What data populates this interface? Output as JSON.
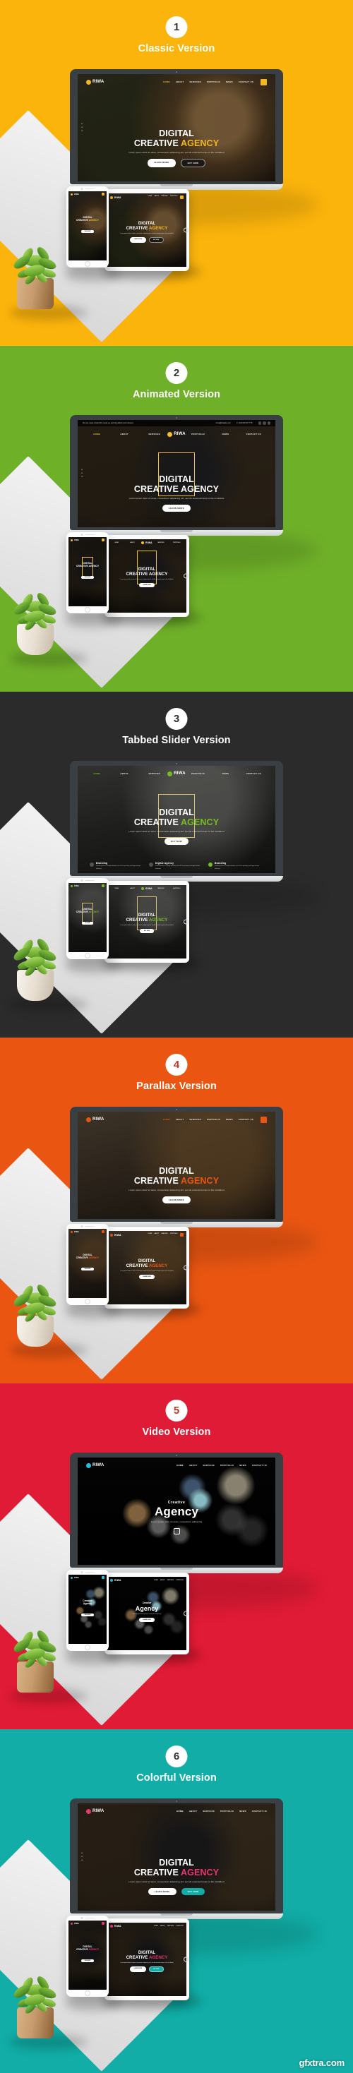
{
  "sections": [
    {
      "number": "1",
      "title": "Classic Version",
      "bg_color": "#FBB40C",
      "badge_num_color": "#333333",
      "accent": "#F2B722",
      "site": {
        "logo": "RIWA",
        "nav": [
          "HOME",
          "ABOUT",
          "SERVICES",
          "PORTFOLIO",
          "NEWS",
          "CONTACT US"
        ],
        "hero_line1": "DIGITAL",
        "hero_line2_plain": "CREATIVE ",
        "hero_line2_accent": "AGENCY",
        "hero_sub": "Lorem ipsum dolor sit amet, consectetur adipiscing elit, sed do eiusmod tempo to the incididunt",
        "btn_primary": "LEARN MORE",
        "btn_secondary": "BUY NOW",
        "side_labels": [
          "01",
          "02",
          "03"
        ]
      }
    },
    {
      "number": "2",
      "title": "Animated Version",
      "bg_color": "#6FB029",
      "badge_num_color": "#333333",
      "accent": "#F2C12E",
      "site": {
        "logo": "RIWA",
        "topbar_left": "We can create a brand the needs we and truly affects your business",
        "topbar_mail": "hq@riwasite.com",
        "topbar_phone": "+234 000 33 77 55",
        "nav": [
          "HOME",
          "ABOUT",
          "SERVICES",
          "PORTFOLIO",
          "NEWS",
          "CONTACT US"
        ],
        "hero_line1": "DIGITAL",
        "hero_line2_plain": "CREATIVE AGENCY",
        "hero_line2_accent": "",
        "hero_sub": "Lorem ipsum dolor sit amet, consectetur adipiscing elit, sed do eiusmodt temp to the incididunt",
        "btn_primary": "LEARN MORE",
        "btn_secondary": "",
        "side_labels": [
          "01",
          "02",
          "03"
        ]
      }
    },
    {
      "number": "3",
      "title": "Tabbed Slider  Version",
      "bg_color": "#2B2B2B",
      "badge_num_color": "#333333",
      "accent": "#79B928",
      "site": {
        "logo": "RIWA",
        "nav": [
          "HOME",
          "ABOUT",
          "SERVICES",
          "PORTFOLIO",
          "NEWS",
          "CONTACT US"
        ],
        "hero_line1": "DIGITAL",
        "hero_line2_plain": "CREATIVE ",
        "hero_line2_accent": "AGENCY",
        "hero_sub": "Lorem ipsum dolor sit amet, consectetur adipiscing elit, sed do eiusmod tempo to the incididunt",
        "btn_primary": "BUY NOW",
        "btn_secondary": "",
        "side_labels": [],
        "tabs": [
          {
            "label": "Branding",
            "desc": "Lorem ipsum is simply dummy text of the printing and typesetting industry",
            "active": false
          },
          {
            "label": "Digital Agency",
            "desc": "Lorem ipsum is simply dummy text of the printing and typesetting industry",
            "active": false
          },
          {
            "label": "Branding",
            "desc": "Lorem ipsum is simply dummy text of the printing and typesetting industry",
            "active": true
          }
        ]
      }
    },
    {
      "number": "4",
      "title": "Parallax Version",
      "bg_color": "#EA5612",
      "badge_num_color": "#C0392B",
      "accent": "#EA5612",
      "site": {
        "logo": "RIWA",
        "nav": [
          "HOME",
          "ABOUT",
          "SERVICES",
          "PORTFOLIO",
          "NEWS",
          "CONTACT US"
        ],
        "hero_line1": "DIGITAL",
        "hero_line2_plain": "CREATIVE ",
        "hero_line2_accent": "AGENCY",
        "hero_sub": "Lorem ipsum dolor sit amet, consectetur adipiscing elit, sed do eiusmod tempo to the incididunt",
        "btn_primary": "LEARN MORE",
        "btn_secondary": "",
        "side_labels": []
      }
    },
    {
      "number": "5",
      "title": "Video Version",
      "bg_color": "#E01B35",
      "badge_num_color": "#C0392B",
      "accent": "#22C2DE",
      "site": {
        "logo": "RIWA",
        "nav": [
          "HOME",
          "ABOUT",
          "SERVICES",
          "PORTFOLIO",
          "NEWS",
          "CONTACT US"
        ],
        "hero_line1": "Creative",
        "hero_line2_plain": "Agency",
        "hero_line2_accent": "",
        "hero_sub": "Lorem ipsum dolor sit amet, consectetur adipiscing",
        "btn_primary": "LEARN MORE",
        "btn_secondary": "",
        "side_labels": []
      }
    },
    {
      "number": "6",
      "title": "Colorful Version",
      "bg_color": "#11ADA6",
      "badge_num_color": "#333333",
      "accent": "#E8376E",
      "site": {
        "logo": "RIWA",
        "nav": [
          "HOME",
          "ABOUT",
          "SERVICES",
          "PORTFOLIO",
          "NEWS",
          "CONTACT US"
        ],
        "hero_line1": "DIGITAL",
        "hero_line2_plain": "CREATIVE ",
        "hero_line2_accent": "AGENCY",
        "hero_sub": "Lorem ipsum dolor sit amet, consectetur adipiscing elit, sed do eiusmod tempo to the incididunt",
        "btn_primary": "LEARN MORE",
        "btn_secondary": "BUY NOW",
        "side_labels": [
          "01",
          "02",
          "03"
        ]
      }
    }
  ],
  "watermark": "gfxtra.com"
}
